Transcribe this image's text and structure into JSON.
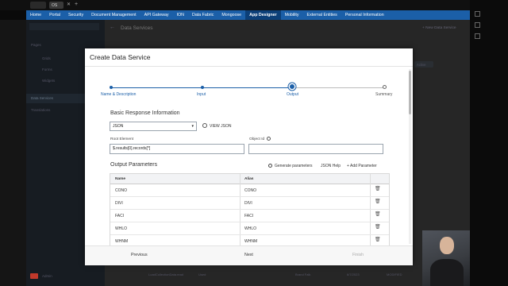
{
  "browser": {
    "tab_label": "OS"
  },
  "nav": {
    "items": [
      "Home",
      "Portal",
      "Security",
      "Document Management",
      "API Gateway",
      "ION",
      "Data Fabric",
      "Mongoose",
      "App Designer",
      "Mobility",
      "External Entities",
      "Personal Information"
    ],
    "active_index": 8
  },
  "background_page": {
    "title": "Data Services",
    "new_button": "+ New Data Service",
    "status_badge": "Active",
    "row_label": "LoadCollectionData.read",
    "row_type": "Used",
    "row_owner": "Brand Falk",
    "row_date": "6/7/2023",
    "row_status": "MODIFIED"
  },
  "sidebar": {
    "items": [
      "Pages",
      "Grids",
      "Forms",
      "Widgets",
      "Data Services",
      "Translations"
    ],
    "footer_label": "Admin"
  },
  "modal": {
    "title": "Create Data Service",
    "steps": [
      "Name & Description",
      "Input",
      "Output",
      "Summary"
    ],
    "active_step": 2,
    "section_basic": "Basic Response Information",
    "format_value": "JSON",
    "view_json": "VIEW JSON",
    "root_element_label": "Root Element",
    "root_element_value": "$.results[0].records[*]",
    "object_id_label": "Object Id",
    "object_id_value": "",
    "output_params_title": "Output Parameters",
    "generate_params": "Generate parameters",
    "json_help": "JSON Help",
    "add_param": "+ Add Parameter",
    "columns": [
      "Name",
      "Alias"
    ],
    "rows": [
      {
        "name": "CONO",
        "alias": "CONO"
      },
      {
        "name": "DIVI",
        "alias": "DIVI"
      },
      {
        "name": "FACI",
        "alias": "FACI"
      },
      {
        "name": "WHLO",
        "alias": "WHLO"
      },
      {
        "name": "WHNM",
        "alias": "WHNM"
      }
    ],
    "footer": {
      "previous": "Previous",
      "next": "Next",
      "finish": "Finish"
    }
  },
  "colors": {
    "accent": "#1b5fa8",
    "nav_bg": "#1b5fa8"
  }
}
